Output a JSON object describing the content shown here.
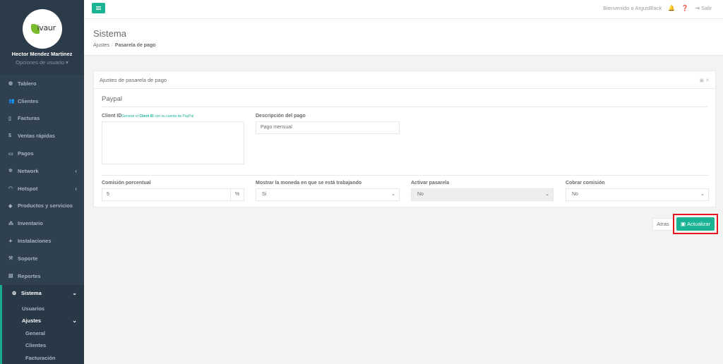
{
  "brand": {
    "logo_text": "ivaur",
    "accent": "#1ab394",
    "sidebar_bg": "#2f4050"
  },
  "profile": {
    "name": "Hector Mendez Martinez",
    "options_label": "Opciones de usuario ▾"
  },
  "nav": {
    "items": [
      {
        "label": "Tablero",
        "icon": "dashboard-icon"
      },
      {
        "label": "Clientes",
        "icon": "users-icon"
      },
      {
        "label": "Facturas",
        "icon": "file-icon"
      },
      {
        "label": "Ventas rápidas",
        "icon": "dollar-icon"
      },
      {
        "label": "Pagos",
        "icon": "payments-icon"
      },
      {
        "label": "Network",
        "icon": "network-icon"
      },
      {
        "label": "Hotspot",
        "icon": "wifi-icon"
      },
      {
        "label": "Productos y servicios",
        "icon": "tag-icon"
      },
      {
        "label": "Inventario",
        "icon": "inventory-icon"
      },
      {
        "label": "Instalaciones",
        "icon": "tools-icon"
      },
      {
        "label": "Soporte",
        "icon": "wrench-icon"
      },
      {
        "label": "Reportes",
        "icon": "report-icon"
      },
      {
        "label": "Sistema",
        "icon": "cogs-icon"
      }
    ],
    "sub": {
      "usuarios": "Usuarios",
      "ajustes": "Ajustes",
      "general": "General",
      "clientes": "Clientes",
      "facturacion": "Facturación"
    }
  },
  "topbar": {
    "welcome": "Bienvenido a ArgusBlack",
    "logout": "Salir"
  },
  "heading": {
    "title": "Sistema",
    "crumb_parent": "Ajustes",
    "crumb_current": "Pasarela de pago"
  },
  "panel": {
    "title": "Ajustes de pasarela de pago",
    "section": "Paypal",
    "client_id_label": "Client ID",
    "client_id_hint_pre": "Generar el",
    "client_id_hint_bold": "Client ID",
    "client_id_hint_post": "con su cuenta de PayPal",
    "desc_label": "Descripción del pago",
    "desc_value": "Pago mensual",
    "commission_label": "Comisión porcentual",
    "commission_value": "5",
    "commission_unit": "%",
    "currency_label": "Mostrar la moneda en que se está trabajando",
    "currency_value": "Si",
    "activate_label": "Activar pasarela",
    "activate_value": "No",
    "charge_label": "Cobrar comisión",
    "charge_value": "No"
  },
  "actions": {
    "back": "Atras",
    "update": "Actualizar"
  }
}
